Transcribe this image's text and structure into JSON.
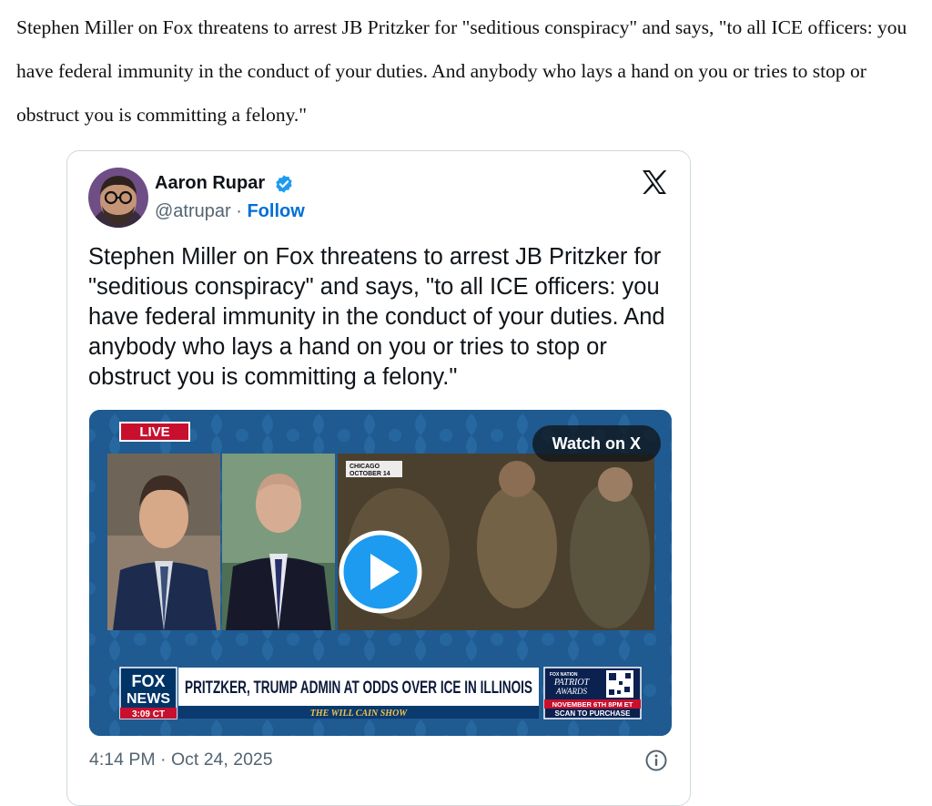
{
  "article": {
    "text": "Stephen Miller on Fox threatens to arrest JB Pritzker for \"seditious conspiracy\" and says, \"to all ICE officers: you have federal immunity in the conduct of your duties. And anybody who lays a hand on you or tries to stop or obstruct you is committing a felony.\""
  },
  "tweet": {
    "author_name": "Aaron Rupar",
    "handle": "@atrupar",
    "separator": "·",
    "follow_label": "Follow",
    "text": "Stephen Miller on Fox threatens to arrest JB Pritzker for \"seditious conspiracy\" and says, \"to all ICE officers: you have federal immunity in the conduct of your duties. And anybody who lays a hand on you or tries to stop or obstruct you is committing a felony.\"",
    "timestamp": "4:14 PM · Oct 24, 2025",
    "icons": [
      "verified-badge-icon",
      "x-logo-icon",
      "play-icon",
      "info-icon"
    ],
    "colors": {
      "link": "#006fd6",
      "verified": "#1d9bf0",
      "muted": "#536471",
      "border": "#cfd9de"
    }
  },
  "media": {
    "watch_label": "Watch on X",
    "live_label": "LIVE",
    "location_label": "CHICAGO",
    "date_label": "OCTOBER 14",
    "network_line1": "FOX",
    "network_line2": "NEWS",
    "clock": "3:09 CT",
    "headline": "PRITZKER, TRUMP ADMIN AT ODDS OVER ICE IN ILLINOIS",
    "show_name": "THE WILL CAIN SHOW",
    "promo_brand": "FOX NATION",
    "promo_title1": "PATRIOT",
    "promo_title2": "AWARDS",
    "promo_date": "NOVEMBER 6TH 8PM ET",
    "promo_cta": "SCAN TO PURCHASE"
  }
}
